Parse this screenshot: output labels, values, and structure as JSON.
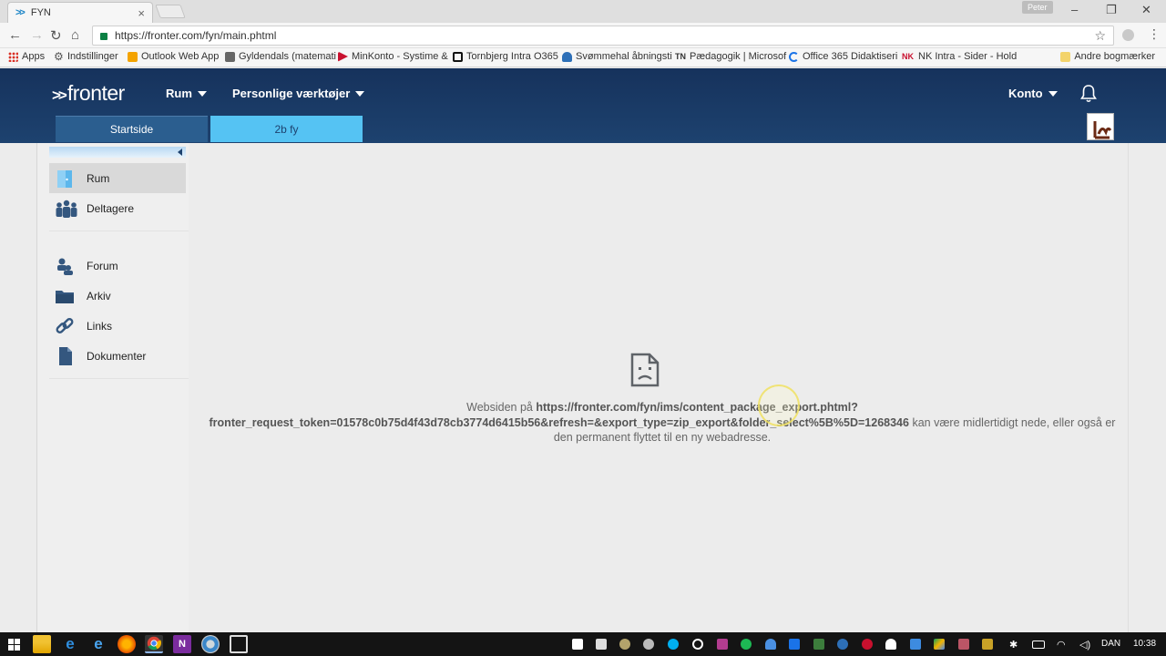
{
  "browser": {
    "tab_title": "FYN",
    "tab_favicon": ">>",
    "profile_name": "Peter",
    "url": "https://fronter.com/fyn/main.phtml",
    "bookmarks": [
      {
        "label": "Apps",
        "icon": "apps-grid-icon",
        "color": "#d93025"
      },
      {
        "label": "Indstillinger",
        "icon": "gear-icon",
        "color": "#555555"
      },
      {
        "label": "Outlook Web App",
        "icon": "outlook-icon",
        "color": "#f4a300"
      },
      {
        "label": "Gyldendals (matemati",
        "icon": "gyldendal-icon",
        "color": "#555555"
      },
      {
        "label": "MinKonto - Systime &",
        "icon": "systime-icon",
        "color": "#c8102e"
      },
      {
        "label": "Tornbjerg Intra O365",
        "icon": "intra-icon",
        "color": "#111111"
      },
      {
        "label": "Svømmehal åbningsti",
        "icon": "swim-icon",
        "color": "#2d6fb7"
      },
      {
        "label": "Pædagogik | Microsof",
        "icon": "tn-icon",
        "color": "#333333",
        "prefix": "TN"
      },
      {
        "label": "Office 365 Didaktiseri",
        "icon": "loading-icon",
        "color": "#1a73e8"
      },
      {
        "label": "NK Intra - Sider - Hold",
        "icon": "nk-icon",
        "color": "#c8102e"
      }
    ],
    "other_bookmarks": "Andre bogmærker"
  },
  "fronter": {
    "logo_chevrons": ">>",
    "logo": "fronter",
    "menu": [
      "Rum",
      "Personlige værktøjer"
    ],
    "account": "Konto",
    "tabs": [
      "Startside",
      "2b fy"
    ]
  },
  "sidebar": {
    "items": [
      {
        "label": "Rum",
        "icon": "room-icon",
        "selected": true
      },
      {
        "label": "Deltagere",
        "icon": "participants-icon",
        "selected": false
      },
      {
        "label": "Forum",
        "icon": "forum-icon",
        "selected": false
      },
      {
        "label": "Arkiv",
        "icon": "archive-folder-icon",
        "selected": false
      },
      {
        "label": "Links",
        "icon": "link-icon",
        "selected": false
      },
      {
        "label": "Dokumenter",
        "icon": "document-icon",
        "selected": false
      }
    ]
  },
  "error": {
    "prefix": "Websiden på ",
    "url_line1": "https://fronter.com/fyn/ims/content_package_export.phtml?",
    "url_line2": "fronter_request_token=01578c0b75d4f43d78cb3774d6415b56&refresh=&export_type=zip_export&folder_select%5B%5D=1268346",
    "suffix_line2": " kan være midlertidigt nede, eller også er",
    "line3": "den permanent flyttet til en ny webadresse."
  },
  "taskbar": {
    "language": "DAN",
    "time": "10:38",
    "apps": [
      "file-explorer-icon",
      "edge-icon",
      "internet-explorer-icon",
      "firefox-icon",
      "chrome-icon",
      "onenote-icon",
      "chrome-alt-icon",
      "screen-app-icon"
    ]
  },
  "colors": {
    "fronter_header": "#1d426f",
    "active_tab": "#55c3f3",
    "start_tab": "#2b5e8f"
  }
}
